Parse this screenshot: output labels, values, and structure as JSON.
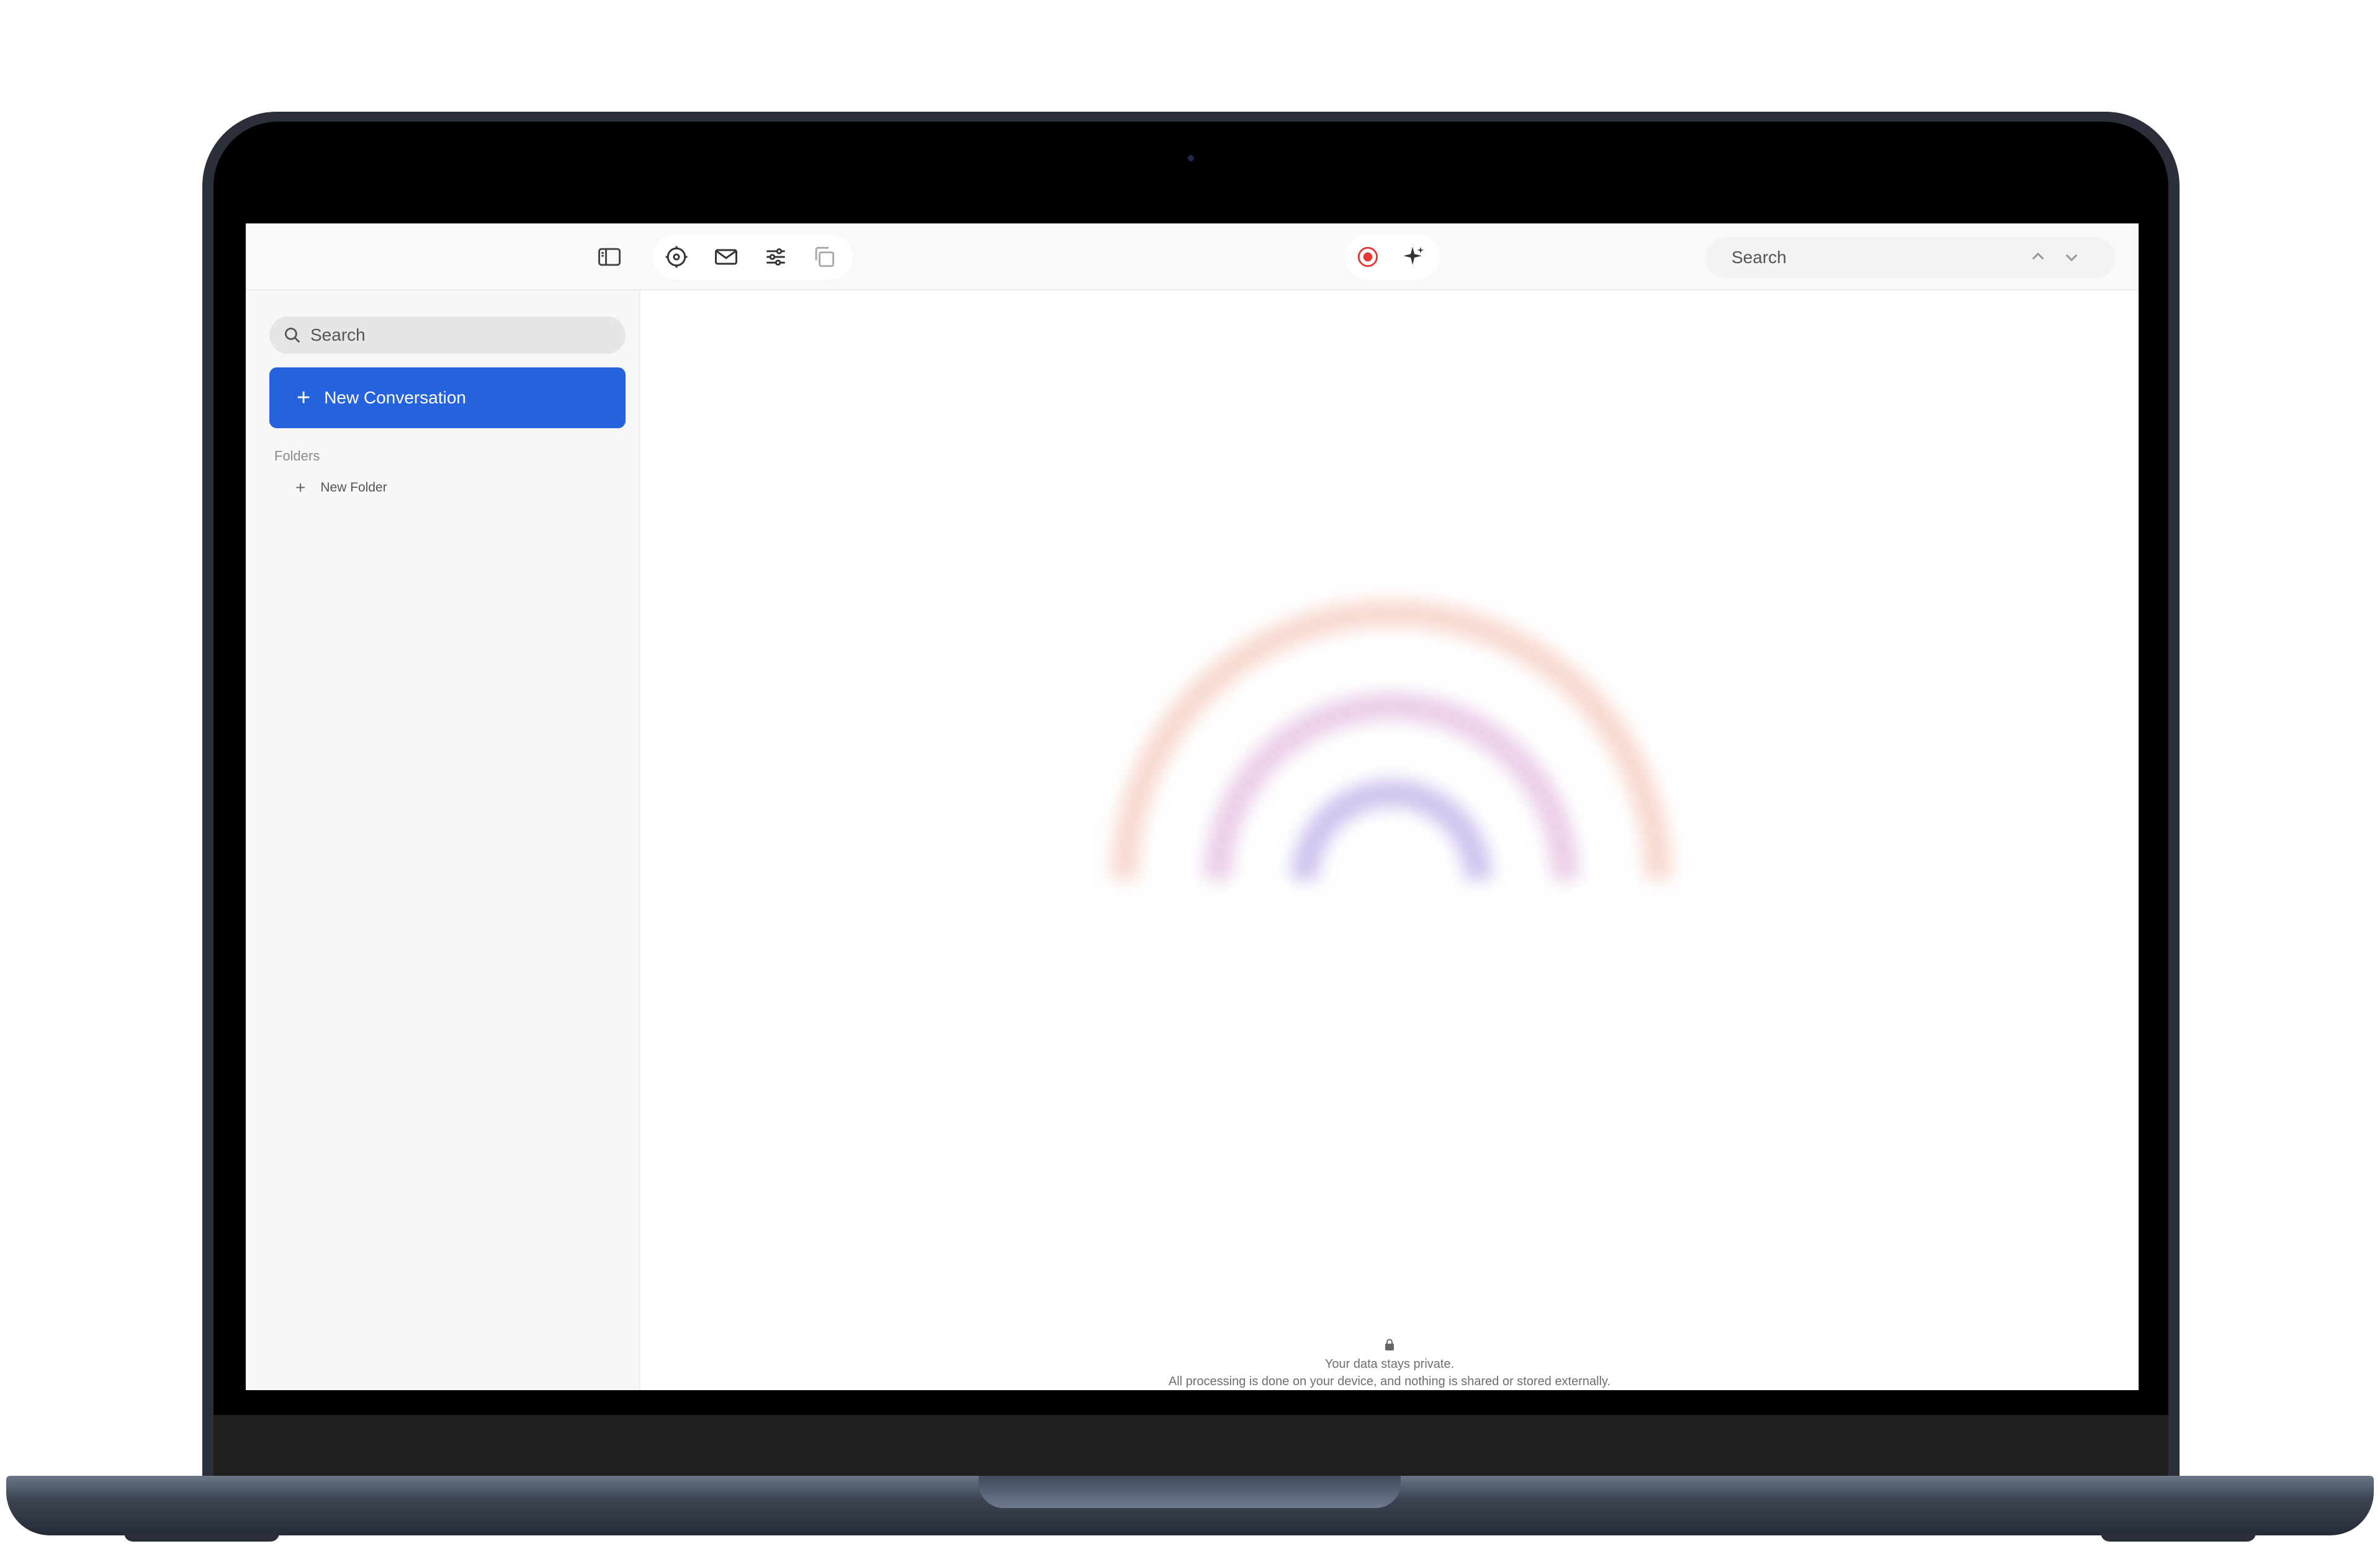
{
  "toolbar": {
    "search_placeholder": "Search"
  },
  "sidebar": {
    "search_placeholder": "Search",
    "new_conversation_label": "New Conversation",
    "folders_label": "Folders",
    "new_folder_label": "New Folder"
  },
  "main": {
    "privacy_title": "Your data stays private.",
    "privacy_detail": "All processing is done on your device, and nothing is shared or stored externally."
  },
  "colors": {
    "accent": "#2563de",
    "record": "#e53935"
  }
}
